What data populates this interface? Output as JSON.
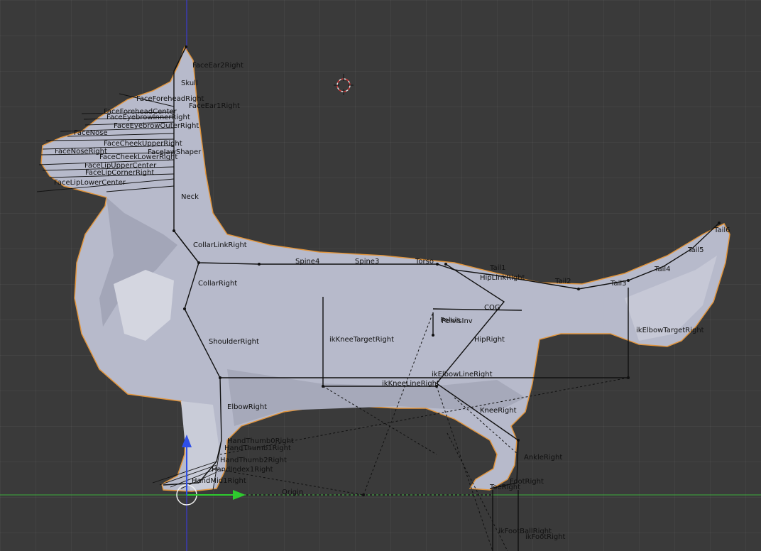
{
  "viewport": {
    "background": "#3a3a3a",
    "mesh_fill": "#b7bacb",
    "outline_color": "#e2953c",
    "bone_color": "#111111",
    "x_axis_color": "#3cae3c",
    "z_axis_color": "#3a3aee"
  },
  "bones": [
    "FaceEar2Right",
    "Skull",
    "FaceForeheadRight",
    "FaceEar1Right",
    "FaceForeheadCenter",
    "FaceEyebrowInnerRight",
    "FaceEyebrowOuterRight",
    "FaceNose",
    "FaceCheekUpperRight",
    "FaceNoseRight",
    "FaceCheekLowerRight",
    "FaceJawShaper",
    "FaceLipUpperCenter",
    "FaceLipCornerRight",
    "FaceLipLowerCenter",
    "Neck",
    "CollarLinkRight",
    "CollarRight",
    "ShoulderRight",
    "ElbowRight",
    "HandThumb0Right",
    "HandThumb1Right",
    "HandThumb2Right",
    "HandIndex1Right",
    "HandMid1Right",
    "Spine4",
    "Spine3",
    "Torso",
    "Tail1",
    "HipLinkRight",
    "Tail2",
    "Tail3",
    "Tail4",
    "Tail5",
    "Tail6",
    "COG",
    "Pelvis",
    "PelvisInv",
    "HipRight",
    "ikKneeTargetRight",
    "ikElbowTargetRight",
    "ikElbowLineRight",
    "ikKneeLineRight",
    "KneeRight",
    "AnkleRight",
    "FootRight",
    "ToeRight",
    "Origin",
    "ikFootBallRight",
    "ikFootRight"
  ]
}
